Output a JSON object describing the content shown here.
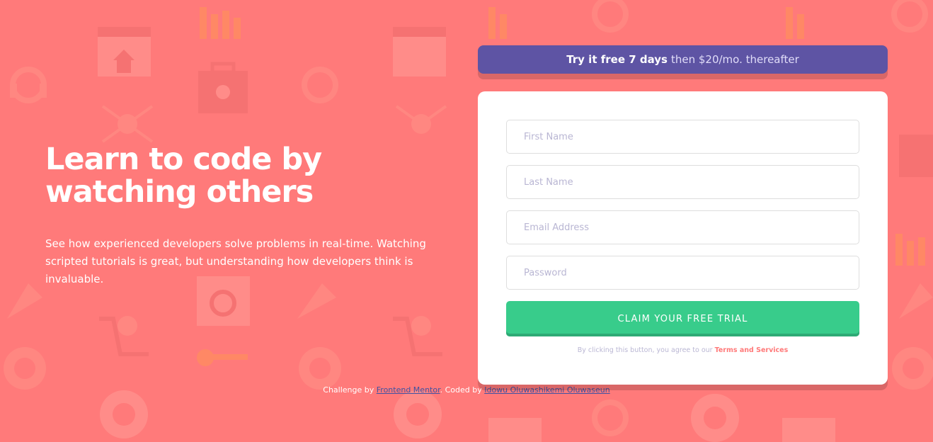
{
  "hero": {
    "title_line1": "Learn to code by",
    "title_line2": "watching others",
    "description": "See how experienced developers solve problems in real-time. Watching scripted tutorials is great, but understanding how developers think is invaluable."
  },
  "banner": {
    "bold": "Try it free 7 days",
    "rest": "then $20/mo. thereafter"
  },
  "form": {
    "first_name_placeholder": "First Name",
    "last_name_placeholder": "Last Name",
    "email_placeholder": "Email Address",
    "password_placeholder": "Password",
    "submit_label": "CLAIM YOUR FREE TRIAL",
    "terms_prefix": "By clicking this button, you agree to our",
    "terms_link": "Terms and Services"
  },
  "attribution": {
    "challenge_prefix": "Challenge by",
    "challenge_link": "Frontend Mentor",
    "coded_prefix": ". Coded by",
    "coded_link": "Idowu Oluwashikemi Oluwaseun"
  },
  "colors": {
    "background": "#ff7a7a",
    "banner": "#5e54a4",
    "cta": "#38cc8b",
    "terms_link": "#ff7a7a"
  },
  "background_icons": [
    "browser-window-icon",
    "headset-icon",
    "toolbox-icon",
    "network-icon",
    "chart-icon",
    "rocket-icon",
    "magnifier-icon",
    "cart-icon",
    "gear-globe-icon",
    "lifebuoy-icon",
    "key-icon",
    "calendar-icon"
  ]
}
